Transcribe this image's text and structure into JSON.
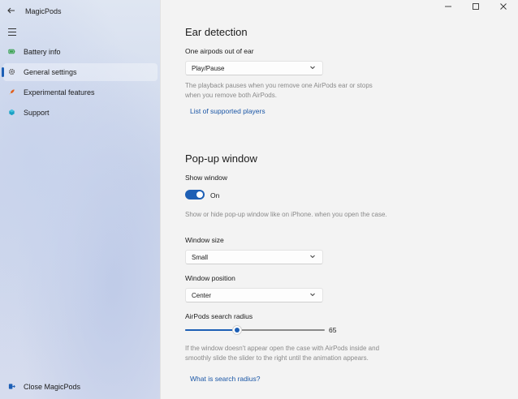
{
  "app": {
    "title": "MagicPods",
    "back_icon": "back-arrow-icon",
    "menu_icon": "hamburger-icon"
  },
  "window_controls": {
    "minimize": "—",
    "maximize": "☐",
    "close": "✕"
  },
  "sidebar": {
    "items": [
      {
        "label": "Battery info",
        "icon": "battery-icon",
        "color": "#2e9e44"
      },
      {
        "label": "General settings",
        "icon": "gear-icon",
        "color": "#5a5a5a",
        "selected": true
      },
      {
        "label": "Experimental features",
        "icon": "rocket-icon",
        "color": "#e0601e"
      },
      {
        "label": "Support",
        "icon": "support-icon",
        "color": "#1aa1c4"
      }
    ],
    "footer": {
      "label": "Close MagicPods",
      "icon": "exit-icon",
      "color": "#1d5fb5"
    }
  },
  "ear_detection": {
    "title": "Ear detection",
    "one_out_label": "One airpods out of ear",
    "one_out_value": "Play/Pause",
    "description": "The playback pauses when you remove one AirPods ear or stops when you remove both AirPods.",
    "link": "List of supported players"
  },
  "popup_window": {
    "title": "Pop-up window",
    "show_window_label": "Show window",
    "toggle_state": "On",
    "toggle_on": true,
    "show_window_desc": "Show or hide pop-up window like on iPhone. when you open the case.",
    "size_label": "Window size",
    "size_value": "Small",
    "position_label": "Window position",
    "position_value": "Center",
    "radius_label": "AirPods search radius",
    "radius_value": "65",
    "radius_fraction": 0.37,
    "radius_desc": "If the window doesn't appear open the case with AirPods inside and smoothly slide the slider to the right until the animation appears.",
    "radius_link": "What is search radius?"
  },
  "colors": {
    "accent": "#1d5fb5",
    "link": "#1a56a6"
  }
}
